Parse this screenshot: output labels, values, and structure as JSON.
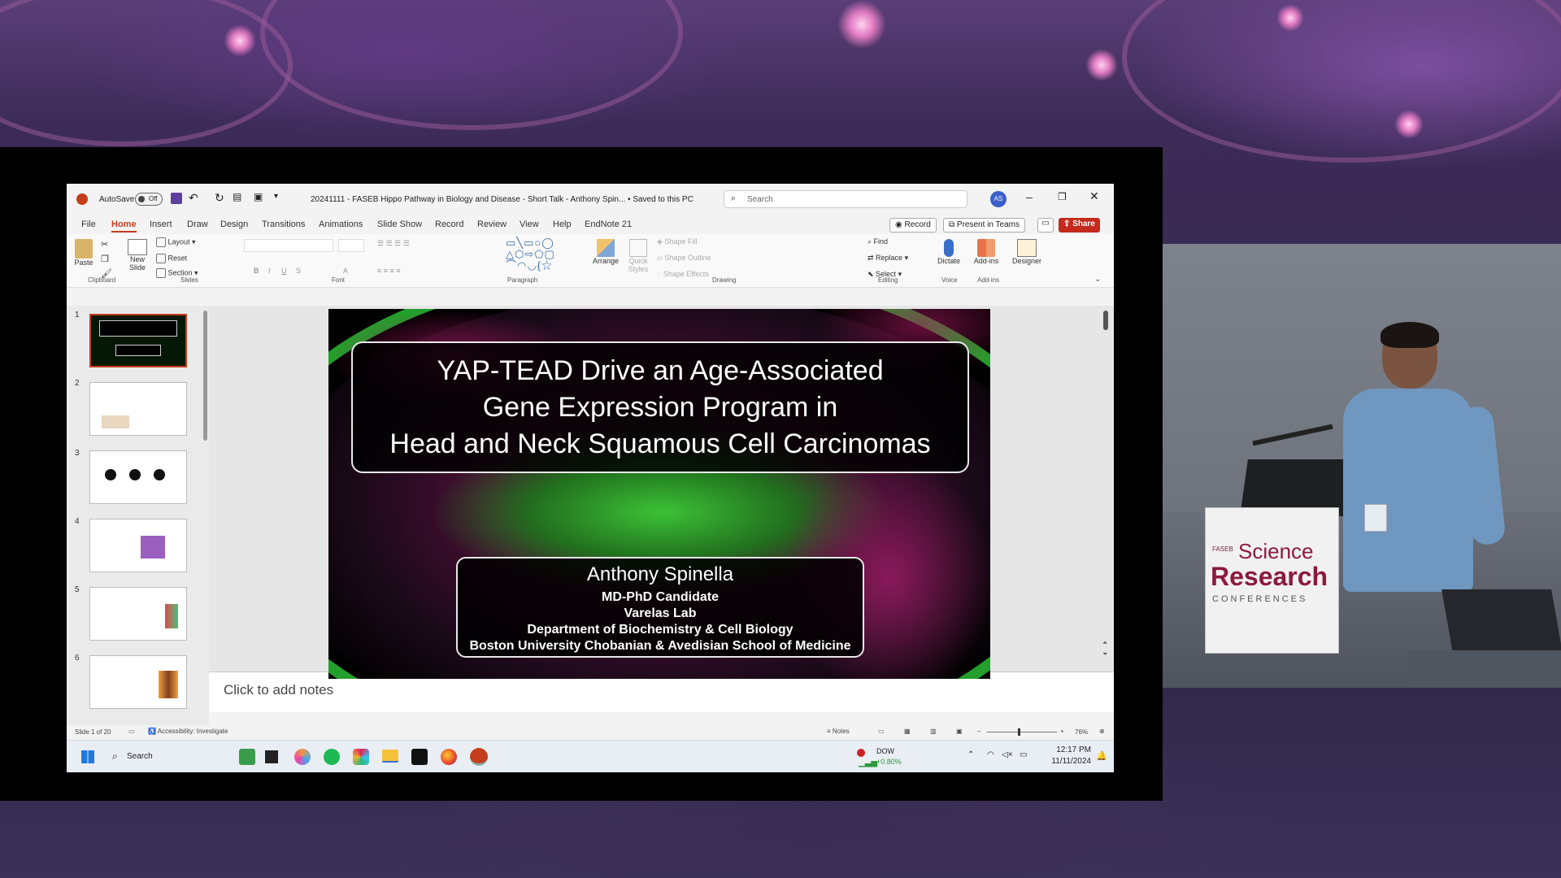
{
  "window": {
    "autosave_label": "AutoSave",
    "autosave_state": "Off",
    "doc_title": "20241111 - FASEB Hippo Pathway in Biology and Disease - Short Talk - Anthony Spin... • Saved to this PC",
    "search_placeholder": "Search",
    "avatar_initials": "AS"
  },
  "menu": {
    "tabs": [
      "File",
      "Home",
      "Insert",
      "Draw",
      "Design",
      "Transitions",
      "Animations",
      "Slide Show",
      "Record",
      "Review",
      "View",
      "Help",
      "EndNote 21"
    ],
    "active": "Home",
    "record_btn": "Record",
    "present_btn": "Present in Teams",
    "share_btn": "Share"
  },
  "ribbon": {
    "paste": "Paste",
    "new_slide": "New Slide",
    "layout": "Layout",
    "reset": "Reset",
    "section": "Section",
    "arrange": "Arrange",
    "quick_styles": "Quick Styles",
    "shape_fill": "Shape Fill",
    "shape_outline": "Shape Outline",
    "shape_effects": "Shape Effects",
    "find": "Find",
    "replace": "Replace",
    "select": "Select",
    "dictate": "Dictate",
    "addins": "Add-ins",
    "designer": "Designer",
    "groups": [
      "Clipboard",
      "Slides",
      "Font",
      "Paragraph",
      "Drawing",
      "Editing",
      "Voice",
      "Add-ins"
    ]
  },
  "thumbnails": [
    "1",
    "2",
    "3",
    "4",
    "5",
    "6"
  ],
  "slide": {
    "title_lines": [
      "YAP-TEAD Drive an Age-Associated",
      "Gene Expression Program in",
      "Head and Neck Squamous Cell Carcinomas"
    ],
    "author": "Anthony Spinella",
    "role": "MD-PhD Candidate",
    "lab": "Varelas Lab",
    "dept": "Department of Biochemistry & Cell Biology",
    "school": "Boston University Chobanian & Avedisian School of Medicine"
  },
  "notes_placeholder": "Click to add notes",
  "status": {
    "slide_count": "Slide 1 of 20",
    "accessibility": "Accessibility: Investigate",
    "notes": "Notes",
    "zoom": "76%"
  },
  "taskbar": {
    "search": "Search",
    "stock_name": "DOW",
    "stock_change": "+0.80%",
    "time": "12:17 PM",
    "date": "11/11/2024"
  },
  "podium": {
    "small": "FASEB",
    "line1": "Science",
    "line2": "Research",
    "line3": "CONFERENCES"
  },
  "colors": {
    "accent": "#c43e1c",
    "share": "#c42b1c",
    "slide_green": "#39e63c",
    "slide_magenta": "#b3126e"
  }
}
